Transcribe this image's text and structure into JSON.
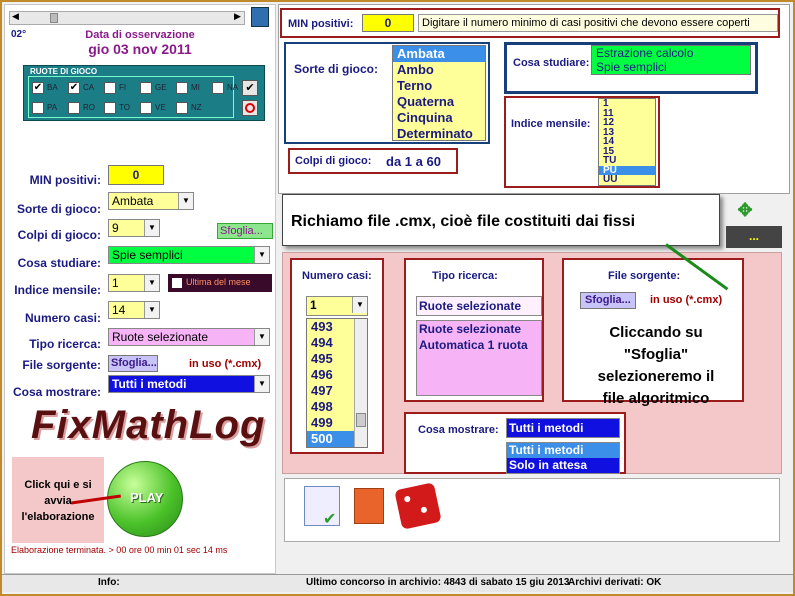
{
  "left": {
    "counter": "02°",
    "date_title": "Data di osservazione",
    "date_value": "gio 03 nov 2011",
    "ruote_title": "RUOTE DI GIOCO",
    "ruote_row1": [
      "BA",
      "CA",
      "FI",
      "GE",
      "MI",
      "NA"
    ],
    "ruote_row2": [
      "PA",
      "RO",
      "TO",
      "VE",
      "NZ"
    ],
    "min_pos_label": "MIN positivi:",
    "min_pos_value": "0",
    "sorte_label": "Sorte di gioco:",
    "sorte_value": "Ambata",
    "colpi_label": "Colpi di gioco:",
    "colpi_value": "9",
    "sfoglia_green": "Sfoglia...",
    "cosa_label": "Cosa studiare:",
    "cosa_value": "Spie semplici",
    "indice_label": "Indice mensile:",
    "indice_value": "1",
    "ultima_label": "Ultima del mese",
    "numcasi_label": "Numero casi:",
    "numcasi_value": "14",
    "tipo_label": "Tipo ricerca:",
    "tipo_value": "Ruote selezionate",
    "file_label": "File sorgente:",
    "file_btn": "Sfoglia...",
    "file_inuso": "in uso (*.cmx)",
    "mostrare_label": "Cosa mostrare:",
    "mostrare_value": "Tutti i metodi",
    "logo": "FixMathLog",
    "click_text": "Click qui e si avvia l'elaborazione",
    "play": "PLAY",
    "status": "Elaborazione terminata. > 00 ore 00 min 01 sec 14 ms"
  },
  "top": {
    "min_label": "MIN positivi:",
    "min_value": "0",
    "min_hint": "Digitare il numero minimo di casi positivi che devono essere coperti"
  },
  "sorte": {
    "label": "Sorte di gioco:",
    "options": [
      "Ambata",
      "Ambo",
      "Terno",
      "Quaterna",
      "Cinquina",
      "Determinato"
    ],
    "selected": 0
  },
  "colpi": {
    "label": "Colpi di gioco:",
    "value": "da 1 a 60"
  },
  "cosa": {
    "label": "Cosa studiare:",
    "options": [
      "Estrazione calcolo",
      "Spie semplici"
    ]
  },
  "indice": {
    "label": "Indice mensile:",
    "options": [
      "1",
      "11",
      "12",
      "13",
      "14",
      "15",
      "TU",
      "PU",
      "UU"
    ],
    "selected": 7
  },
  "callout": "Richiamo file .cmx, cioè file costituiti dai fissi",
  "ellipsis": "...",
  "numcasi": {
    "label": "Numero casi:",
    "selected": "1",
    "options": [
      "493",
      "494",
      "495",
      "496",
      "497",
      "498",
      "499",
      "500"
    ]
  },
  "tipo": {
    "label": "Tipo ricerca:",
    "selected": "Ruote selezionate",
    "options": [
      "Ruote selezionate",
      "Automatica 1 ruota"
    ]
  },
  "file": {
    "label": "File sorgente:",
    "btn": "Sfoglia...",
    "inuso": "in uso (*.cmx)",
    "note": "Cliccando su \"Sfoglia\" selezioneremo il file algoritmico"
  },
  "mostrare": {
    "label": "Cosa mostrare:",
    "selected": "Tutti i metodi",
    "options": [
      "Tutti i metodi",
      "Solo in attesa"
    ]
  },
  "statusbar": {
    "info": "Info:",
    "concorso": "Ultimo concorso in archivio: 4843 di sabato 15 giu 2013",
    "archivi": "Archivi derivati: OK"
  }
}
